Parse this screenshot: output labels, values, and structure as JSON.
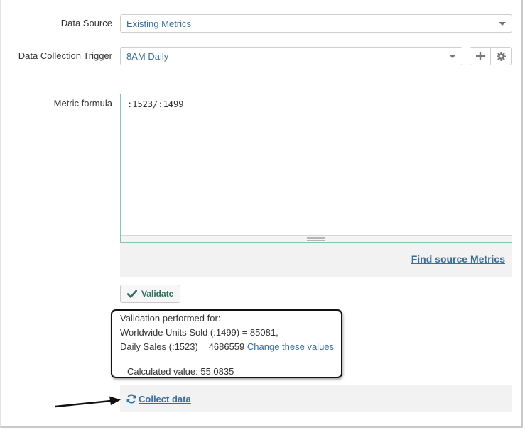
{
  "form": {
    "data_source_label": "Data Source",
    "data_source_value": "Existing Metrics",
    "trigger_label": "Data Collection Trigger",
    "trigger_value": "8AM Daily",
    "formula_label": "Metric formula",
    "formula_value": ":1523/:1499",
    "find_source_label": "Find source Metrics",
    "validate_label": "Validate"
  },
  "validation": {
    "heading": "Validation performed for:",
    "line1": "Worldwide Units Sold (:1499) = 85081,",
    "line2_prefix": "Daily Sales (:1523) = 4686559",
    "change_link": "Change these values",
    "calculated": "Calculated value: 55.0835"
  },
  "collect": {
    "label": "Collect data"
  },
  "icons": {
    "add": "plus-icon",
    "settings": "gear-icon",
    "validate": "checkmark-icon",
    "collect": "refresh-icon"
  },
  "colors": {
    "link": "#3a6e9a",
    "textarea_border": "#7fc7b5",
    "validate_text": "#2f6f60"
  }
}
